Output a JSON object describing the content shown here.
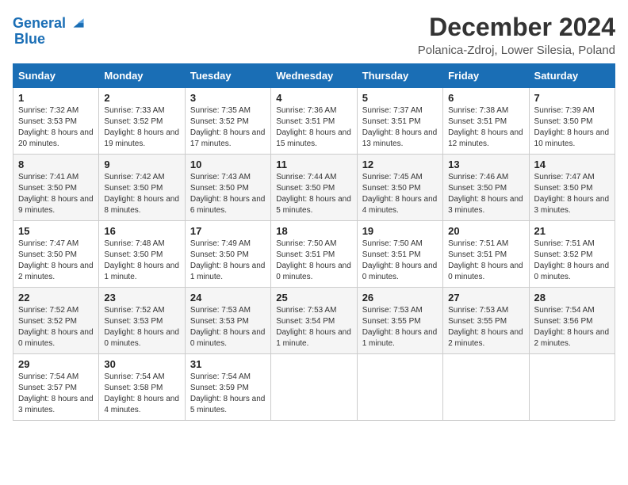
{
  "logo": {
    "line1": "General",
    "line2": "Blue",
    "icon_color": "#1a6eb5"
  },
  "title": "December 2024",
  "subtitle": "Polanica-Zdroj, Lower Silesia, Poland",
  "days_of_week": [
    "Sunday",
    "Monday",
    "Tuesday",
    "Wednesday",
    "Thursday",
    "Friday",
    "Saturday"
  ],
  "weeks": [
    [
      {
        "day": "1",
        "sunrise": "Sunrise: 7:32 AM",
        "sunset": "Sunset: 3:53 PM",
        "daylight": "Daylight: 8 hours and 20 minutes."
      },
      {
        "day": "2",
        "sunrise": "Sunrise: 7:33 AM",
        "sunset": "Sunset: 3:52 PM",
        "daylight": "Daylight: 8 hours and 19 minutes."
      },
      {
        "day": "3",
        "sunrise": "Sunrise: 7:35 AM",
        "sunset": "Sunset: 3:52 PM",
        "daylight": "Daylight: 8 hours and 17 minutes."
      },
      {
        "day": "4",
        "sunrise": "Sunrise: 7:36 AM",
        "sunset": "Sunset: 3:51 PM",
        "daylight": "Daylight: 8 hours and 15 minutes."
      },
      {
        "day": "5",
        "sunrise": "Sunrise: 7:37 AM",
        "sunset": "Sunset: 3:51 PM",
        "daylight": "Daylight: 8 hours and 13 minutes."
      },
      {
        "day": "6",
        "sunrise": "Sunrise: 7:38 AM",
        "sunset": "Sunset: 3:51 PM",
        "daylight": "Daylight: 8 hours and 12 minutes."
      },
      {
        "day": "7",
        "sunrise": "Sunrise: 7:39 AM",
        "sunset": "Sunset: 3:50 PM",
        "daylight": "Daylight: 8 hours and 10 minutes."
      }
    ],
    [
      {
        "day": "8",
        "sunrise": "Sunrise: 7:41 AM",
        "sunset": "Sunset: 3:50 PM",
        "daylight": "Daylight: 8 hours and 9 minutes."
      },
      {
        "day": "9",
        "sunrise": "Sunrise: 7:42 AM",
        "sunset": "Sunset: 3:50 PM",
        "daylight": "Daylight: 8 hours and 8 minutes."
      },
      {
        "day": "10",
        "sunrise": "Sunrise: 7:43 AM",
        "sunset": "Sunset: 3:50 PM",
        "daylight": "Daylight: 8 hours and 6 minutes."
      },
      {
        "day": "11",
        "sunrise": "Sunrise: 7:44 AM",
        "sunset": "Sunset: 3:50 PM",
        "daylight": "Daylight: 8 hours and 5 minutes."
      },
      {
        "day": "12",
        "sunrise": "Sunrise: 7:45 AM",
        "sunset": "Sunset: 3:50 PM",
        "daylight": "Daylight: 8 hours and 4 minutes."
      },
      {
        "day": "13",
        "sunrise": "Sunrise: 7:46 AM",
        "sunset": "Sunset: 3:50 PM",
        "daylight": "Daylight: 8 hours and 3 minutes."
      },
      {
        "day": "14",
        "sunrise": "Sunrise: 7:47 AM",
        "sunset": "Sunset: 3:50 PM",
        "daylight": "Daylight: 8 hours and 3 minutes."
      }
    ],
    [
      {
        "day": "15",
        "sunrise": "Sunrise: 7:47 AM",
        "sunset": "Sunset: 3:50 PM",
        "daylight": "Daylight: 8 hours and 2 minutes."
      },
      {
        "day": "16",
        "sunrise": "Sunrise: 7:48 AM",
        "sunset": "Sunset: 3:50 PM",
        "daylight": "Daylight: 8 hours and 1 minute."
      },
      {
        "day": "17",
        "sunrise": "Sunrise: 7:49 AM",
        "sunset": "Sunset: 3:50 PM",
        "daylight": "Daylight: 8 hours and 1 minute."
      },
      {
        "day": "18",
        "sunrise": "Sunrise: 7:50 AM",
        "sunset": "Sunset: 3:51 PM",
        "daylight": "Daylight: 8 hours and 0 minutes."
      },
      {
        "day": "19",
        "sunrise": "Sunrise: 7:50 AM",
        "sunset": "Sunset: 3:51 PM",
        "daylight": "Daylight: 8 hours and 0 minutes."
      },
      {
        "day": "20",
        "sunrise": "Sunrise: 7:51 AM",
        "sunset": "Sunset: 3:51 PM",
        "daylight": "Daylight: 8 hours and 0 minutes."
      },
      {
        "day": "21",
        "sunrise": "Sunrise: 7:51 AM",
        "sunset": "Sunset: 3:52 PM",
        "daylight": "Daylight: 8 hours and 0 minutes."
      }
    ],
    [
      {
        "day": "22",
        "sunrise": "Sunrise: 7:52 AM",
        "sunset": "Sunset: 3:52 PM",
        "daylight": "Daylight: 8 hours and 0 minutes."
      },
      {
        "day": "23",
        "sunrise": "Sunrise: 7:52 AM",
        "sunset": "Sunset: 3:53 PM",
        "daylight": "Daylight: 8 hours and 0 minutes."
      },
      {
        "day": "24",
        "sunrise": "Sunrise: 7:53 AM",
        "sunset": "Sunset: 3:53 PM",
        "daylight": "Daylight: 8 hours and 0 minutes."
      },
      {
        "day": "25",
        "sunrise": "Sunrise: 7:53 AM",
        "sunset": "Sunset: 3:54 PM",
        "daylight": "Daylight: 8 hours and 1 minute."
      },
      {
        "day": "26",
        "sunrise": "Sunrise: 7:53 AM",
        "sunset": "Sunset: 3:55 PM",
        "daylight": "Daylight: 8 hours and 1 minute."
      },
      {
        "day": "27",
        "sunrise": "Sunrise: 7:53 AM",
        "sunset": "Sunset: 3:55 PM",
        "daylight": "Daylight: 8 hours and 2 minutes."
      },
      {
        "day": "28",
        "sunrise": "Sunrise: 7:54 AM",
        "sunset": "Sunset: 3:56 PM",
        "daylight": "Daylight: 8 hours and 2 minutes."
      }
    ],
    [
      {
        "day": "29",
        "sunrise": "Sunrise: 7:54 AM",
        "sunset": "Sunset: 3:57 PM",
        "daylight": "Daylight: 8 hours and 3 minutes."
      },
      {
        "day": "30",
        "sunrise": "Sunrise: 7:54 AM",
        "sunset": "Sunset: 3:58 PM",
        "daylight": "Daylight: 8 hours and 4 minutes."
      },
      {
        "day": "31",
        "sunrise": "Sunrise: 7:54 AM",
        "sunset": "Sunset: 3:59 PM",
        "daylight": "Daylight: 8 hours and 5 minutes."
      },
      null,
      null,
      null,
      null
    ]
  ]
}
